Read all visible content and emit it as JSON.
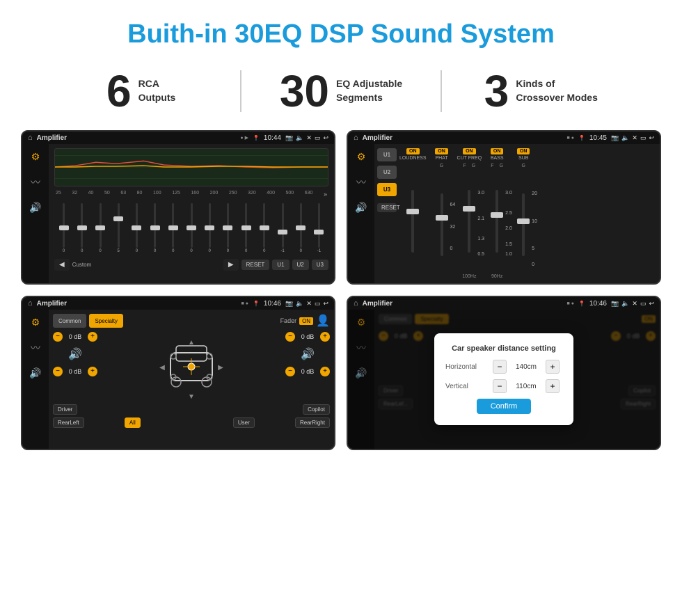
{
  "page": {
    "title": "Buith-in 30EQ DSP Sound System"
  },
  "stats": [
    {
      "number": "6",
      "label": "RCA\nOutputs"
    },
    {
      "number": "30",
      "label": "EQ Adjustable\nSegments"
    },
    {
      "number": "3",
      "label": "Kinds of\nCrossover Modes"
    }
  ],
  "screens": {
    "eq": {
      "title": "Amplifier",
      "time": "10:44",
      "freqs": [
        "25",
        "32",
        "40",
        "50",
        "63",
        "80",
        "100",
        "125",
        "160",
        "200",
        "250",
        "320",
        "400",
        "500",
        "630"
      ],
      "vals": [
        "0",
        "0",
        "0",
        "5",
        "0",
        "0",
        "0",
        "0",
        "0",
        "0",
        "0",
        "0",
        "-1",
        "0",
        "-1"
      ],
      "buttons": [
        "Custom",
        "RESET",
        "U1",
        "U2",
        "U3"
      ]
    },
    "crossover": {
      "title": "Amplifier",
      "time": "10:45",
      "presets": [
        "U1",
        "U2",
        "U3"
      ],
      "channels": [
        {
          "label": "LOUDNESS",
          "on": true
        },
        {
          "label": "PHAT",
          "on": true
        },
        {
          "label": "CUT FREQ",
          "on": true
        },
        {
          "label": "BASS",
          "on": true
        },
        {
          "label": "SUB",
          "on": true
        }
      ]
    },
    "fader": {
      "title": "Amplifier",
      "time": "10:46",
      "tabs": [
        "Common",
        "Specialty"
      ],
      "fader_label": "Fader",
      "fader_on": true,
      "top_db": "0 dB",
      "bottom_db": "0 dB",
      "right_top_db": "0 dB",
      "right_bottom_db": "0 dB",
      "position_labels": [
        "Driver",
        "",
        "Copilot",
        "RearLeft",
        "All",
        "",
        "User",
        "RearRight"
      ]
    },
    "distance": {
      "title": "Amplifier",
      "time": "10:46",
      "modal": {
        "title": "Car speaker distance setting",
        "horizontal_label": "Horizontal",
        "horizontal_value": "140cm",
        "vertical_label": "Vertical",
        "vertical_value": "110cm",
        "confirm_label": "Confirm"
      },
      "top_db": "0 dB",
      "bottom_db": "0 dB"
    }
  }
}
